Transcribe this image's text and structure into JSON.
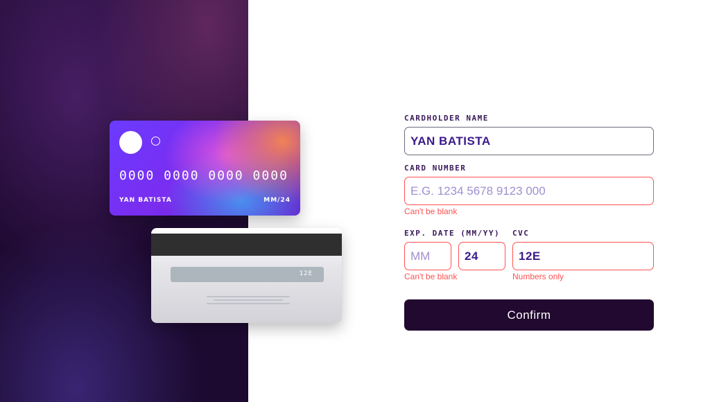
{
  "card_front": {
    "number": "0000 0000 0000 0000",
    "name": "YAN BATISTA",
    "expiry": "MM/24"
  },
  "card_back": {
    "cvc": "12E"
  },
  "form": {
    "cardholder_label": "CARDHOLDER NAME",
    "cardholder_value": "YAN BATISTA",
    "card_number_label": "CARD NUMBER",
    "card_number_placeholder": "E.G. 1234 5678 9123 000",
    "card_number_error": "Can't be blank",
    "exp_label": "EXP. DATE (MM/YY)",
    "exp_month_placeholder": "MM",
    "exp_year_value": "24",
    "exp_error": "Can't be blank",
    "cvc_label": "CVC",
    "cvc_value": "12E",
    "cvc_error": "Numbers only",
    "confirm_label": "Confirm"
  },
  "colors": {
    "error": "#ff5050",
    "button": "#21092f",
    "label": "#3a1a5a"
  }
}
